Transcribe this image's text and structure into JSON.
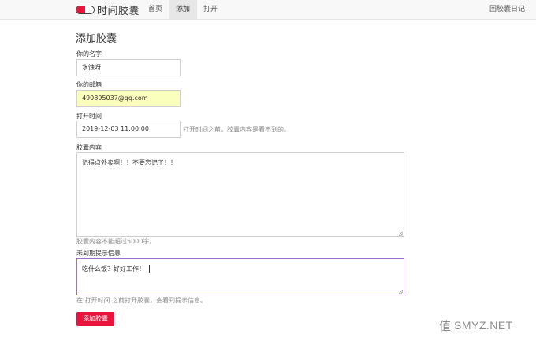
{
  "app": {
    "brand_name": "时间胶囊"
  },
  "nav": {
    "items": [
      {
        "label": "首页",
        "active": false
      },
      {
        "label": "添加",
        "active": true
      },
      {
        "label": "打开",
        "active": false
      }
    ],
    "right_link": "回胶囊日记"
  },
  "form": {
    "title": "添加胶囊",
    "name": {
      "label": "你的名字",
      "value": "水蚀呀"
    },
    "email": {
      "label": "你的邮箱",
      "value": "490895037@qq.com"
    },
    "open_time": {
      "label": "打开时间",
      "value": "2019-12-03 11:00:00",
      "help": "打开时间之前，胶囊内容是看不到的。"
    },
    "content": {
      "label": "胶囊内容",
      "value": "记得点外卖啊！！不要忘记了！！",
      "help": "胶囊内容不能超过5000字。"
    },
    "early_message": {
      "label": "未到期提示信息",
      "value": "吃什么饭？好好工作！",
      "help": "在 打开时间 之前打开胶囊，会看到提示信息。"
    },
    "submit_label": "添加胶囊"
  },
  "watermark": {
    "text": "SMYZ.NET"
  },
  "colors": {
    "accent": "#e8143c",
    "autofill": "#faffbd",
    "focus_border": "#9b6fd0"
  }
}
